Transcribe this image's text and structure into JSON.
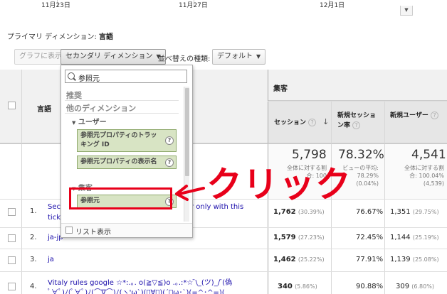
{
  "chart": {
    "dates": [
      "11月23日",
      "11月27日",
      "12月1日"
    ],
    "expand_icon": "chevron-down-icon"
  },
  "primary_dimension": {
    "label": "プライマリ ディメンション:",
    "value": "言語"
  },
  "toolbar": {
    "graph_button": "グラフに表示",
    "secondary_dimension_button": "セカンダリ ディメンション",
    "sort_type_label": "並べ替えの種類:",
    "sort_type_value": "デフォルト"
  },
  "dropdown": {
    "search_value": "参照元",
    "categories": {
      "recommended": "推奨",
      "other": "他のディメンション"
    },
    "group_user": "ユーザー",
    "items": [
      "参照元プロパティのトラッキング ID",
      "参照元プロパティの表示名",
      "参照元"
    ],
    "partial_group": "集客",
    "footer_label": "リスト表示",
    "help_icon": "?"
  },
  "table": {
    "header": {
      "dimension": "言語",
      "group": "集客",
      "columns": [
        "セッション",
        "新規セッション率",
        "新規ユーザー"
      ]
    },
    "totals": {
      "sessions": "5,798",
      "sessions_sub": [
        "全体に対する割",
        "合: 100"
      ],
      "new_session_rate": "78.32%",
      "new_session_rate_sub": [
        "ビューの平均:",
        "78.29%",
        "(0.04%)"
      ],
      "new_users": "4,541",
      "new_users_sub": [
        "全体に対する割",
        "合: 100.04%",
        "(4,539)"
      ]
    },
    "rows": [
      {
        "index": "1.",
        "dimension": "Sec",
        "dimension_tail": "r only with this",
        "dimension_line2": "tick",
        "sessions": "1,762",
        "sessions_pct": "(30.39%)",
        "new_session_rate": "76.67%",
        "new_users": "1,351",
        "new_users_pct": "(29.75%)"
      },
      {
        "index": "2.",
        "dimension": "ja-jp",
        "sessions": "1,579",
        "sessions_pct": "(27.23%)",
        "new_session_rate": "72.45%",
        "new_users": "1,144",
        "new_users_pct": "(25.19%)"
      },
      {
        "index": "3.",
        "dimension": "ja",
        "sessions": "1,462",
        "sessions_pct": "(25.22%)",
        "new_session_rate": "77.91%",
        "new_users": "1,139",
        "new_users_pct": "(25.08%)"
      },
      {
        "index": "4.",
        "dimension": "Vitaly rules google ☆*:.｡. o(≧▽≦)o .｡.:*☆ ̄\\_(ツ)_/ ̄(偽",
        "dimension_line2": "ﾟ∀ﾟ)ﾉ(ﾟ∀ﾟ)ﾉ(⌒∇⌒)ﾉ(ヽ'ω`)(ﾟ∀ﾟ)(´･ω･`)(=^･^=)(",
        "sessions": "340",
        "sessions_pct": "(5.86%)",
        "new_session_rate": "90.88%",
        "new_users": "309",
        "new_users_pct": "(6.80%)"
      }
    ]
  },
  "annotation": {
    "text": "クリック",
    "color": "#e8001a"
  }
}
